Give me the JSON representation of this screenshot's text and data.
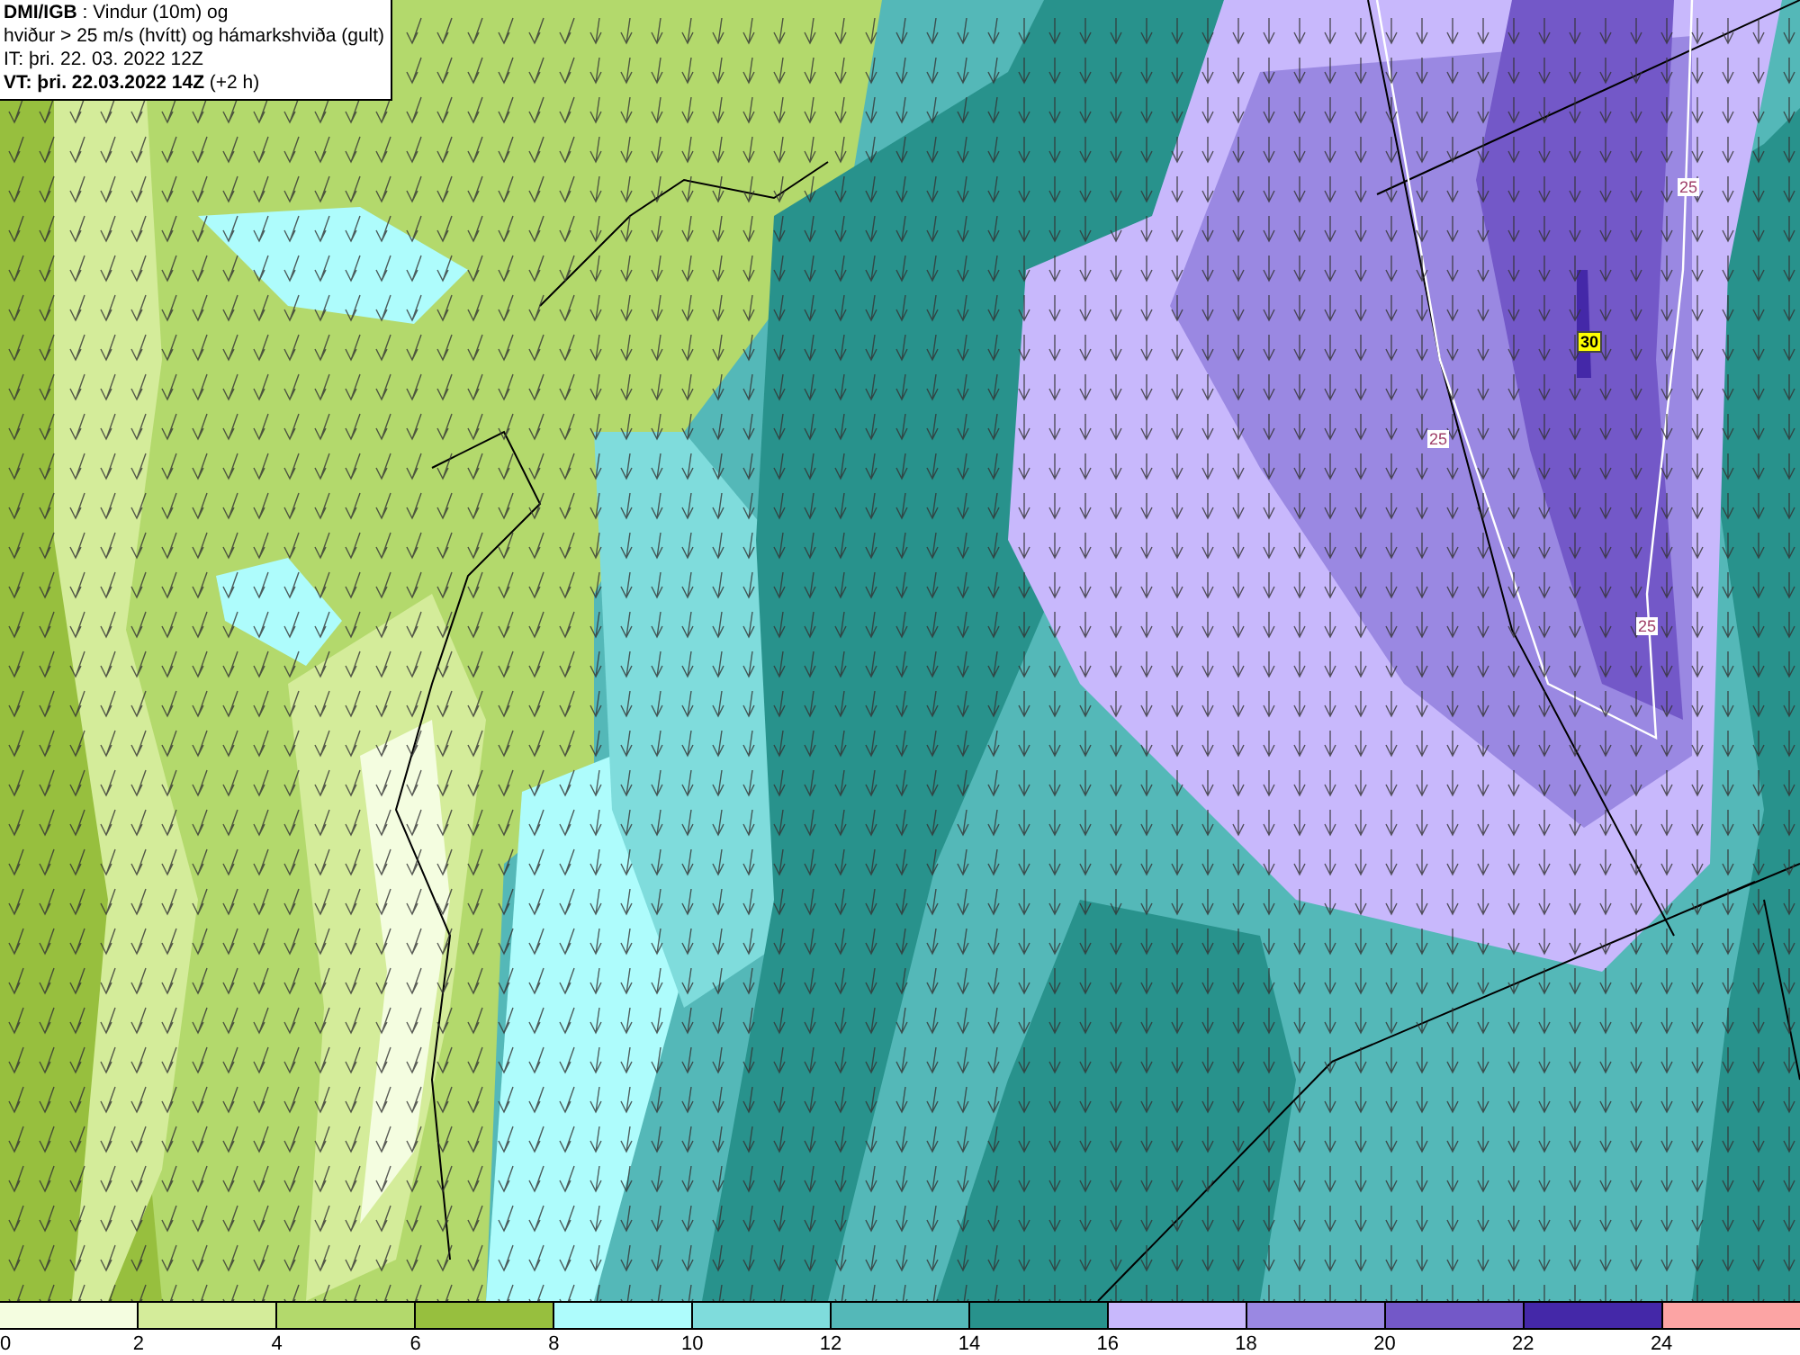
{
  "title_box": {
    "lines": [
      "**DMI/IGB** : Vindur (10m) og",
      "hviður > 25 m/s (hvítt) og hámarkshviða (gult)",
      "IT: þri. 22. 03. 2022 12Z",
      "**VT: þri. 22.03.2022 14Z** (+2 h)"
    ]
  },
  "contour_labels": [
    {
      "text": "25",
      "kind": "gust"
    },
    {
      "text": "25",
      "kind": "gust"
    },
    {
      "text": "25",
      "kind": "gust"
    },
    {
      "text": "30",
      "kind": "max"
    }
  ],
  "legend": [
    {
      "label": "0",
      "color": "#f4fde0"
    },
    {
      "label": "2",
      "color": "#d4ec9a"
    },
    {
      "label": "4",
      "color": "#b3d96c"
    },
    {
      "label": "6",
      "color": "#97bf3e"
    },
    {
      "label": "8",
      "color": "#aefcfc"
    },
    {
      "label": "10",
      "color": "#7fdcdc"
    },
    {
      "label": "12",
      "color": "#54b8b8"
    },
    {
      "label": "14",
      "color": "#28928c"
    },
    {
      "label": "16",
      "color": "#c8b8fc"
    },
    {
      "label": "18",
      "color": "#9a88e2"
    },
    {
      "label": "20",
      "color": "#7358c8"
    },
    {
      "label": "22",
      "color": "#4428a8"
    },
    {
      "label": "24",
      "color": "#fca4a4"
    }
  ]
}
